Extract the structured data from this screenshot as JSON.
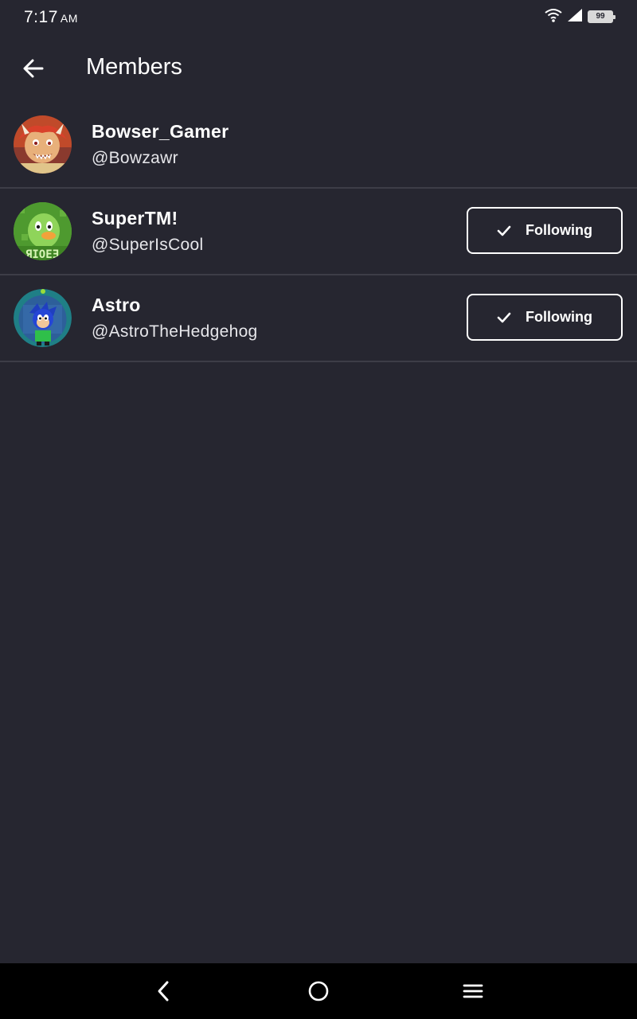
{
  "status_bar": {
    "time": "7:17",
    "ampm": "AM",
    "battery": "99"
  },
  "app_bar": {
    "title": "Members"
  },
  "members": [
    {
      "name": "Bowser_Gamer",
      "handle": "@Bowzawr",
      "follow_label": null,
      "avatar": "bowser-character-avatar"
    },
    {
      "name": "SuperTM!",
      "handle": "@SuperIsCool",
      "follow_label": "Following",
      "avatar": "green-bird-avatar"
    },
    {
      "name": "Astro",
      "handle": "@AstroTheHedgehog",
      "follow_label": "Following",
      "avatar": "blue-hedgehog-avatar"
    }
  ],
  "colors": {
    "background": "#262630",
    "divider": "#3d3d47",
    "text": "#ffffff",
    "nav_bar": "#000000"
  }
}
